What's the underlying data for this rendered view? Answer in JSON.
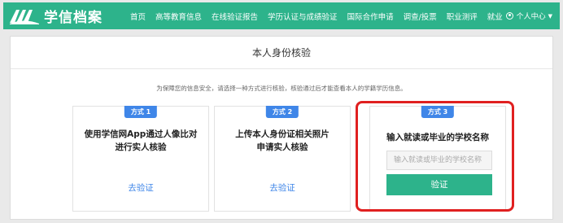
{
  "header": {
    "logo_text": "学信档案",
    "nav": [
      "首页",
      "高等教育信息",
      "在线验证报告",
      "学历认证与成绩验证",
      "国际合作申请",
      "调查/投票",
      "职业测评",
      "就业"
    ],
    "user_label": "个人中心",
    "accent_color": "#2db38b"
  },
  "main": {
    "title": "本人身份核验",
    "notice": "为保障您的信息安全，请选择一种方式进行核验，核验通过后才能查看本人的学籍学历信息。",
    "options": [
      {
        "badge": "方式 1",
        "title_line1": "使用学信网App通过人像比对",
        "title_line2": "进行实人核验",
        "link": "去验证"
      },
      {
        "badge": "方式 2",
        "title_line1": "上传本人身份证相关照片",
        "title_line2": "申请实人核验",
        "link": "去验证"
      },
      {
        "badge": "方式 3",
        "title_line1": "输入就读或毕业的学校名称",
        "input_placeholder": "输入就读或毕业的学校名称",
        "button": "验证"
      }
    ]
  },
  "colors": {
    "badge": "#3f86e8",
    "highlight": "#e02020",
    "link": "#3f86e8"
  }
}
